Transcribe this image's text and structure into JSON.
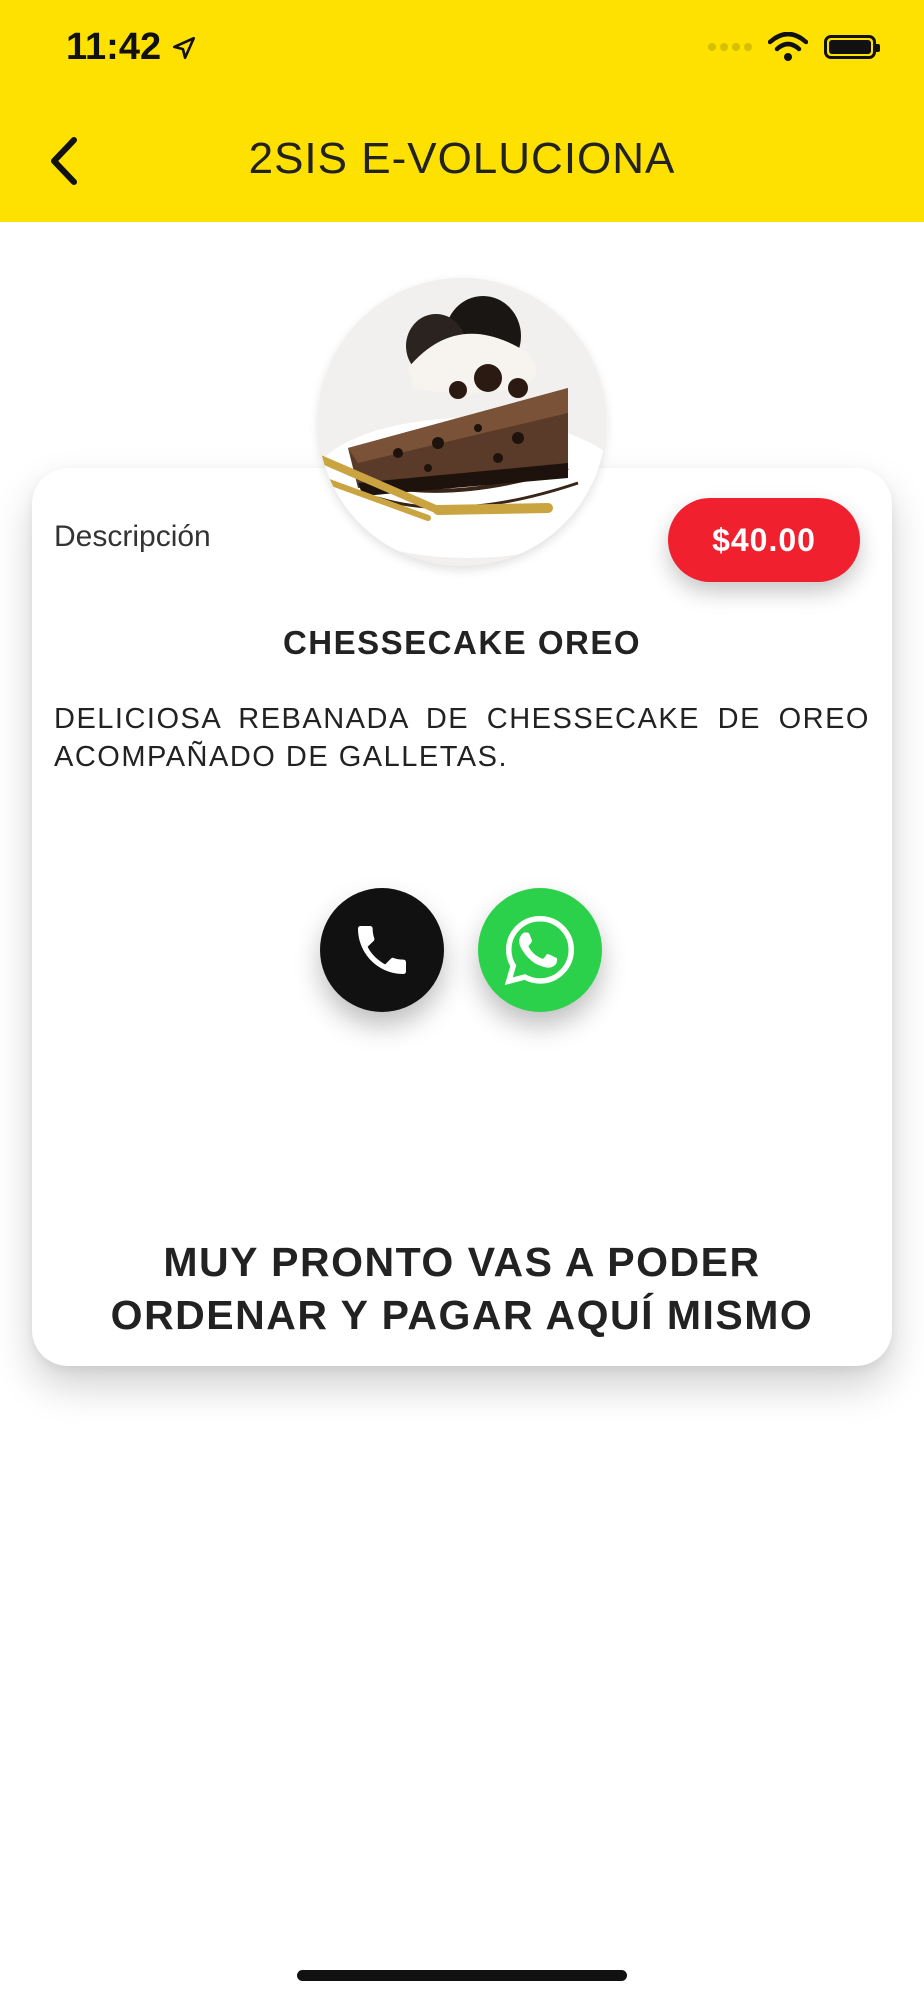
{
  "status_bar": {
    "time": "11:42"
  },
  "header": {
    "title": "2SIS E-VOLUCIONA",
    "back_icon": "chevron-left-icon",
    "background": "#ffe100"
  },
  "product": {
    "image_alt": "cheesecake-oreo-photo",
    "description_label": "Descripción",
    "price": "$40.00",
    "name": "CHESSECAKE OREO",
    "description": "DELICIOSA REBANADA DE CHESSECAKE DE OREO ACOMPAÑADO DE GALLETAS."
  },
  "actions": {
    "call_icon": "phone-icon",
    "whatsapp_icon": "whatsapp-icon",
    "call_color": "#111111",
    "whatsapp_color": "#2bd14a"
  },
  "notice": {
    "line1": "MUY PRONTO VAS A PODER",
    "line2": "ORDENAR Y PAGAR AQUÍ MISMO"
  },
  "colors": {
    "accent": "#ffe100",
    "price_badge": "#f0202f"
  }
}
